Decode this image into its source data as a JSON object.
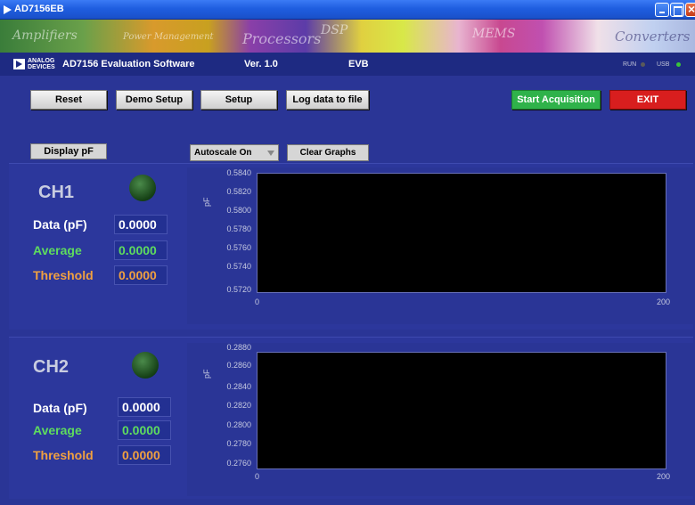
{
  "window": {
    "title": "AD7156EB"
  },
  "banner": {
    "words": [
      "Amplifiers",
      "Power Management",
      "Processors",
      "DSP",
      "MEMS",
      "Converters"
    ]
  },
  "header": {
    "logo_line1": "ANALOG",
    "logo_line2": "DEVICES",
    "app_name": "AD7156 Evaluation Software",
    "version": "Ver. 1.0",
    "board": "EVB",
    "run_label": "RUN",
    "usb_label": "USB",
    "colors": {
      "run_led": "#5a5a5a",
      "usb_led": "#3ac43a"
    }
  },
  "toolbar": {
    "reset": "Reset",
    "demo_setup": "Demo Setup",
    "setup": "Setup",
    "log": "Log data to file",
    "start": "Start Acquisition",
    "exit": "EXIT",
    "colors": {
      "start": "#2fb24a",
      "exit": "#d81e1e"
    }
  },
  "controls": {
    "display_mode": "Display pF",
    "autoscale": "Autoscale On",
    "clear": "Clear Graphs"
  },
  "channels": [
    {
      "name": "CH1",
      "data_label": "Data (pF)",
      "data_value": "0.0000",
      "avg_label": "Average",
      "avg_value": "0.0000",
      "thr_label": "Threshold",
      "thr_value": "0.0000",
      "chart_unit": "pF",
      "yticks": [
        "0.5840",
        "0.5820",
        "0.5800",
        "0.5780",
        "0.5760",
        "0.5740",
        "0.5720"
      ],
      "xticks": [
        "0",
        "200"
      ]
    },
    {
      "name": "CH2",
      "data_label": "Data (pF)",
      "data_value": "0.0000",
      "avg_label": "Average",
      "avg_value": "0.0000",
      "thr_label": "Threshold",
      "thr_value": "0.0000",
      "chart_unit": "pF",
      "yticks": [
        "0.2880",
        "0.2860",
        "0.2840",
        "0.2820",
        "0.2800",
        "0.2780",
        "0.2760"
      ],
      "xticks": [
        "0",
        "200"
      ]
    }
  ]
}
